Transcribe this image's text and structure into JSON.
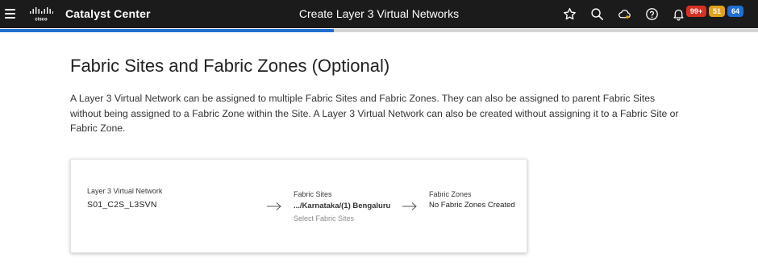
{
  "header": {
    "app_title": "Catalyst Center",
    "page_title": "Create Layer 3 Virtual Networks",
    "icons": [
      "menu-icon",
      "cisco-logo",
      "star-icon",
      "search-icon",
      "cloud-icon",
      "help-icon",
      "bell-icon"
    ],
    "badges": [
      {
        "label": "99+",
        "color": "#d93025"
      },
      {
        "label": "51",
        "color": "#e0a21b"
      },
      {
        "label": "64",
        "color": "#1f6fd1"
      }
    ]
  },
  "progress": {
    "value_percent": 44,
    "color": "#1f6fd1"
  },
  "main": {
    "section_title": "Fabric Sites and Fabric Zones (Optional)",
    "description": "A Layer 3 Virtual Network can be assigned to multiple Fabric Sites and Fabric Zones. They can also be assigned to parent Fabric Sites without being assigned to a Fabric Zone within the Site. A Layer 3 Virtual Network can also be created without assigning it to a Fabric Site or Fabric Zone.",
    "card": {
      "vn_label": "Layer 3 Virtual Network",
      "vn_value": "S01_C2S_L3SVN",
      "sites_label": "Fabric Sites",
      "sites_value": ".../Karnataka/(1) Bengaluru",
      "sites_link": "Select Fabric Sites",
      "zones_label": "Fabric Zones",
      "zones_value": "No Fabric Zones Created"
    }
  }
}
